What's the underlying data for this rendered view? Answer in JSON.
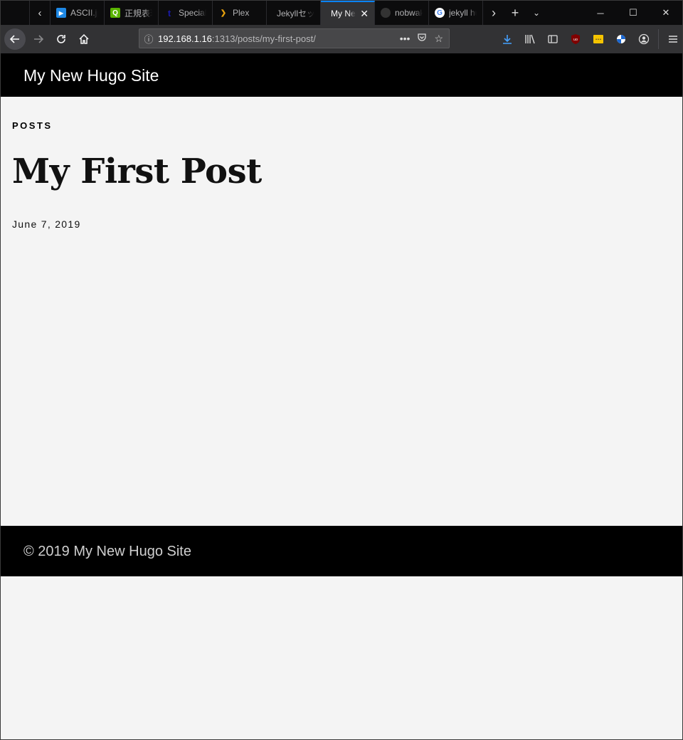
{
  "browser": {
    "tabs": [
      {
        "title": "ASCII.jp",
        "icon": "play-icon",
        "color": "#1e88e5"
      },
      {
        "title": "正規表現",
        "icon": "q-icon",
        "color": "#59b300"
      },
      {
        "title": "Special",
        "icon": "t-icon",
        "color": "#1a1aa6"
      },
      {
        "title": "Plex",
        "icon": "plex-icon",
        "color": "#e5a00d"
      },
      {
        "title": "Jekyllセットアップ",
        "icon": "",
        "color": ""
      },
      {
        "title": "My New Hugo Site",
        "icon": "",
        "color": "",
        "active": true
      },
      {
        "title": "nobwak",
        "icon": "github-icon",
        "color": "#333333"
      },
      {
        "title": "jekyll hugo",
        "icon": "google-icon",
        "color": "#4285f4"
      }
    ],
    "url_host": "192.168.1.16",
    "url_path": ":1313/posts/my-first-post/"
  },
  "site": {
    "title": "My New Hugo Site",
    "footer": "© 2019 My New Hugo Site"
  },
  "post": {
    "section": "POSTS",
    "title": "My First Post",
    "date": "June 7, 2019"
  }
}
